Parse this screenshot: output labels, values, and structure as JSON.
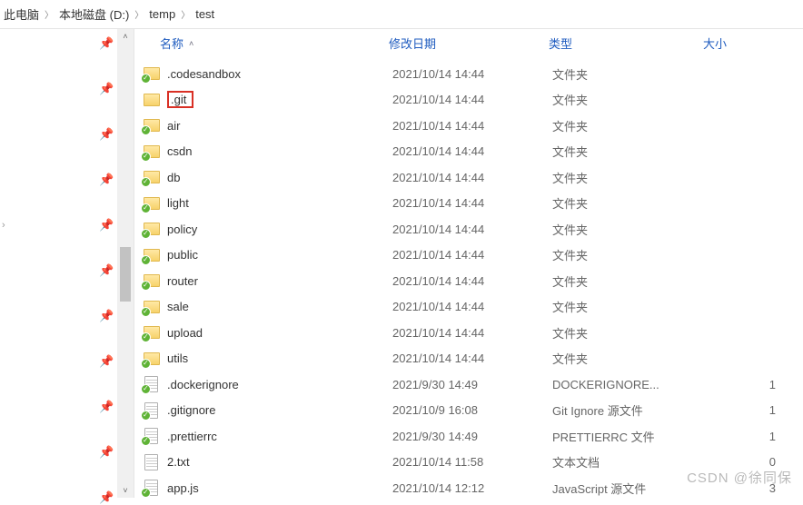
{
  "breadcrumb": {
    "items": [
      "此电脑",
      "本地磁盘 (D:)",
      "temp",
      "test"
    ]
  },
  "columns": {
    "name": "名称",
    "date": "修改日期",
    "type": "类型",
    "size": "大小"
  },
  "rows": [
    {
      "name": ".codesandbox",
      "date": "2021/10/14 14:44",
      "type": "文件夹",
      "size": "",
      "icon": "folder",
      "check": true
    },
    {
      "name": ".git",
      "date": "2021/10/14 14:44",
      "type": "文件夹",
      "size": "",
      "icon": "folder",
      "check": false,
      "highlight": true
    },
    {
      "name": "air",
      "date": "2021/10/14 14:44",
      "type": "文件夹",
      "size": "",
      "icon": "folder",
      "check": true
    },
    {
      "name": "csdn",
      "date": "2021/10/14 14:44",
      "type": "文件夹",
      "size": "",
      "icon": "folder",
      "check": true
    },
    {
      "name": "db",
      "date": "2021/10/14 14:44",
      "type": "文件夹",
      "size": "",
      "icon": "folder",
      "check": true
    },
    {
      "name": "light",
      "date": "2021/10/14 14:44",
      "type": "文件夹",
      "size": "",
      "icon": "folder",
      "check": true
    },
    {
      "name": "policy",
      "date": "2021/10/14 14:44",
      "type": "文件夹",
      "size": "",
      "icon": "folder",
      "check": true
    },
    {
      "name": "public",
      "date": "2021/10/14 14:44",
      "type": "文件夹",
      "size": "",
      "icon": "folder",
      "check": true
    },
    {
      "name": "router",
      "date": "2021/10/14 14:44",
      "type": "文件夹",
      "size": "",
      "icon": "folder",
      "check": true
    },
    {
      "name": "sale",
      "date": "2021/10/14 14:44",
      "type": "文件夹",
      "size": "",
      "icon": "folder",
      "check": true
    },
    {
      "name": "upload",
      "date": "2021/10/14 14:44",
      "type": "文件夹",
      "size": "",
      "icon": "folder",
      "check": true
    },
    {
      "name": "utils",
      "date": "2021/10/14 14:44",
      "type": "文件夹",
      "size": "",
      "icon": "folder",
      "check": true
    },
    {
      "name": ".dockerignore",
      "date": "2021/9/30 14:49",
      "type": "DOCKERIGNORE...",
      "size": "1",
      "icon": "file",
      "check": true
    },
    {
      "name": ".gitignore",
      "date": "2021/10/9 16:08",
      "type": "Git Ignore 源文件",
      "size": "1",
      "icon": "file",
      "check": true
    },
    {
      "name": ".prettierrc",
      "date": "2021/9/30 14:49",
      "type": "PRETTIERRC 文件",
      "size": "1",
      "icon": "file",
      "check": true
    },
    {
      "name": "2.txt",
      "date": "2021/10/14 11:58",
      "type": "文本文档",
      "size": "0",
      "icon": "file",
      "check": false
    },
    {
      "name": "app.js",
      "date": "2021/10/14 12:12",
      "type": "JavaScript 源文件",
      "size": "3",
      "icon": "file",
      "check": true
    }
  ],
  "watermark": "CSDN @徐同保"
}
